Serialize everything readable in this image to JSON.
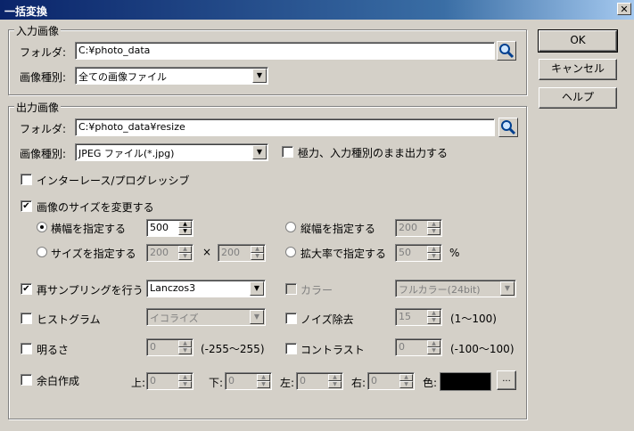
{
  "window": {
    "title": "一括変換",
    "close_glyph": "✕"
  },
  "buttons": {
    "ok": "OK",
    "cancel": "キャンセル",
    "help": "ヘルプ",
    "color_pick": "..."
  },
  "input_group": {
    "legend": "入力画像",
    "folder_label": "フォルダ:",
    "folder_value": "C:¥photo_data",
    "type_label": "画像種別:",
    "type_value": "全ての画像ファイル"
  },
  "output_group": {
    "legend": "出力画像",
    "folder_label": "フォルダ:",
    "folder_value": "C:¥photo_data¥resize",
    "type_label": "画像種別:",
    "type_value": "JPEG ファイル(*.jpg)",
    "keep_type_label": "極力、入力種別のまま出力する",
    "interlace_label": "インターレース/プログレッシブ",
    "resize_label": "画像のサイズを変更する",
    "width_label": "横幅を指定する",
    "width_value": "500",
    "height_label": "縦幅を指定する",
    "height_value": "200",
    "size_label": "サイズを指定する",
    "size_w_value": "200",
    "size_x": "×",
    "size_h_value": "200",
    "scale_label": "拡大率で指定する",
    "scale_value": "50",
    "scale_unit": "%",
    "resample_label": "再サンプリングを行う",
    "resample_value": "Lanczos3",
    "color_label": "カラー",
    "color_value": "フルカラー(24bit)",
    "histogram_label": "ヒストグラム",
    "histogram_value": "イコライズ",
    "noise_label": "ノイズ除去",
    "noise_value": "15",
    "noise_range": "(1〜100)",
    "brightness_label": "明るさ",
    "brightness_value": "0",
    "brightness_range": "(-255〜255)",
    "contrast_label": "コントラスト",
    "contrast_value": "0",
    "contrast_range": "(-100〜100)",
    "margin_label": "余白作成",
    "top_label": "上:",
    "top_value": "0",
    "bottom_label": "下:",
    "bottom_value": "0",
    "left_label": "左:",
    "left_value": "0",
    "right_label": "右:",
    "right_value": "0",
    "color_pick_label": "色:",
    "margin_color": "#000000"
  },
  "icons": {
    "search": "magnifier-icon",
    "dropdown": "chevron-down-icon",
    "check": "✔",
    "spin_up": "▲",
    "spin_down": "▼",
    "dd_glyph": "▼"
  }
}
